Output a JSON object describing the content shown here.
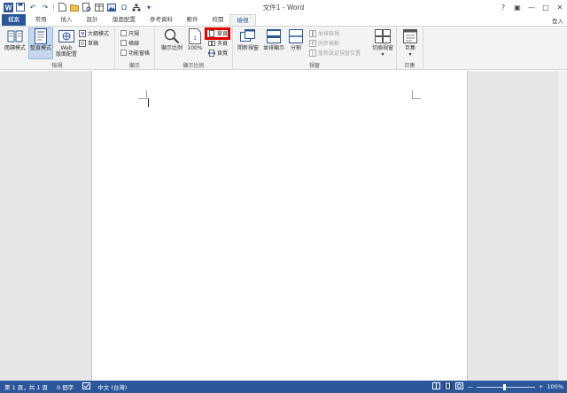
{
  "title_bar": {
    "title": "文件1 - Word",
    "quick_access": [
      "save-icon",
      "undo-icon",
      "redo-icon",
      "new-doc-icon",
      "open-icon",
      "print-preview-icon",
      "table-icon",
      "symbol-icon",
      "customize-icon"
    ],
    "controls": {
      "help": "?",
      "ribbon_display": "▣",
      "minimize": "—",
      "restore": "□",
      "close": "✕"
    }
  },
  "tabs": {
    "file": "檔案",
    "items": [
      "常用",
      "插入",
      "設計",
      "版面配置",
      "參考資料",
      "郵件",
      "校閱",
      "檢視"
    ],
    "active": "檢視",
    "sign_in": "登入"
  },
  "ribbon": {
    "views": {
      "label": "檢視",
      "read_mode": "閱讀模式",
      "print_layout": "整頁模式",
      "web_layout_line1": "Web",
      "web_layout_line2": "版面配置",
      "outline": "大綱模式",
      "draft": "草稿"
    },
    "show": {
      "label": "顯示",
      "ruler": "尺規",
      "gridlines": "格線",
      "nav_pane": "功能窗格"
    },
    "zoom": {
      "label": "顯示比例",
      "zoom": "顯示比例",
      "hundred": "100%",
      "one_page": "單頁",
      "multiple_pages": "多頁",
      "page_width": "頁寬"
    },
    "window": {
      "label": "視窗",
      "new_window": "開新視窗",
      "arrange_all": "並排顯示",
      "split": "分割",
      "side_by_side": "並排檢視",
      "sync_scroll": "同步捲動",
      "reset_position": "重新設定視窗位置",
      "switch_windows": "切換視窗"
    },
    "macros": {
      "label": "巨集",
      "macros": "巨集"
    }
  },
  "status_bar": {
    "page": "第 1 頁，共 1 頁",
    "words": "0 個字",
    "language": "中文 (台灣)",
    "zoom": "100%",
    "zoom_level": 1.0,
    "minus": "—",
    "plus": "+"
  },
  "colors": {
    "accent": "#2b579a",
    "highlight": "#e00000"
  }
}
